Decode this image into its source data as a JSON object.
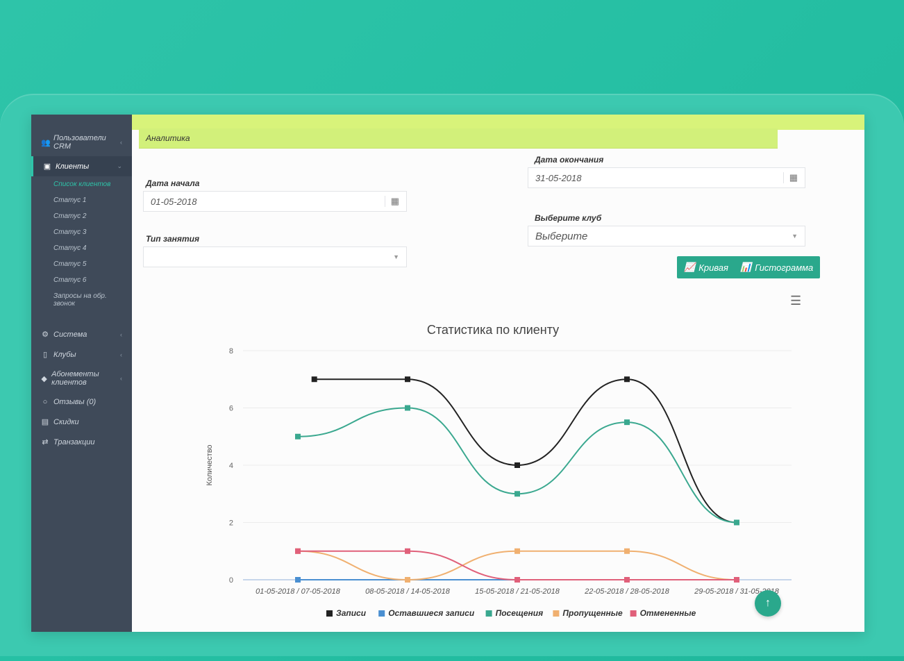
{
  "sidebar": {
    "items": [
      {
        "label": "Пользователи CRM",
        "icon": "users-icon"
      },
      {
        "label": "Клиенты",
        "icon": "id-card-icon"
      },
      {
        "label": "Система",
        "icon": "gear-icon"
      },
      {
        "label": "Клубы",
        "icon": "building-icon"
      },
      {
        "label": "Абонементы клиентов",
        "icon": "diamond-icon"
      },
      {
        "label": "Отзывы (0)",
        "icon": "comment-icon"
      },
      {
        "label": "Скидки",
        "icon": "percent-icon"
      },
      {
        "label": "Транзакции",
        "icon": "exchange-icon"
      }
    ],
    "clients_sub": [
      "Список клиентов",
      "Статус 1",
      "Статус 2",
      "Статус 3",
      "Статус 4",
      "Статус 5",
      "Статус 6",
      "Запросы на обр. звонок"
    ]
  },
  "main": {
    "panel_title": "Аналитика",
    "start_date_label": "Дата начала",
    "start_date_value": "01-05-2018",
    "end_date_label": "Дата окончания",
    "end_date_value": "31-05-2018",
    "lesson_type_label": "Тип занятия",
    "lesson_type_value": "",
    "club_label": "Выберите клуб",
    "club_value": "Выберите",
    "curve_button": "Кривая",
    "histogram_button": "Гистограмма"
  },
  "chart_data": {
    "type": "line",
    "title": "Статистика по клиенту",
    "ylabel": "Количество",
    "ylim": [
      0,
      8
    ],
    "yticks": [
      0,
      2,
      4,
      6,
      8
    ],
    "categories": [
      "01-05-2018 / 07-05-2018",
      "08-05-2018 / 14-05-2018",
      "15-05-2018 / 21-05-2018",
      "22-05-2018 / 28-05-2018",
      "29-05-2018 / 31-05-2018"
    ],
    "series": [
      {
        "name": "Записи",
        "color": "#222222",
        "values": [
          7,
          7,
          4,
          7,
          2
        ],
        "x": [
          0.15,
          1.0,
          2.0,
          3.0,
          4.0
        ]
      },
      {
        "name": "Оставшиеся записи",
        "color": "#4a8fd1",
        "values": [
          0,
          0,
          0,
          0,
          0
        ],
        "x": [
          0,
          1.0,
          2.0,
          3.0,
          4.0
        ]
      },
      {
        "name": "Посещения",
        "color": "#3aa88f",
        "values": [
          5,
          6,
          3,
          5.5,
          2
        ],
        "x": [
          0,
          1.0,
          2.0,
          3.0,
          4.0
        ]
      },
      {
        "name": "Пропущенные",
        "color": "#f0b070",
        "values": [
          1,
          0,
          1,
          1,
          0
        ],
        "x": [
          0,
          1.0,
          2.0,
          3.0,
          4.0
        ]
      },
      {
        "name": "Отмененные",
        "color": "#e0607a",
        "values": [
          1,
          1,
          0,
          0,
          0
        ],
        "x": [
          0,
          1.0,
          2.0,
          3.0,
          4.0
        ]
      }
    ],
    "legend_position": "bottom"
  }
}
